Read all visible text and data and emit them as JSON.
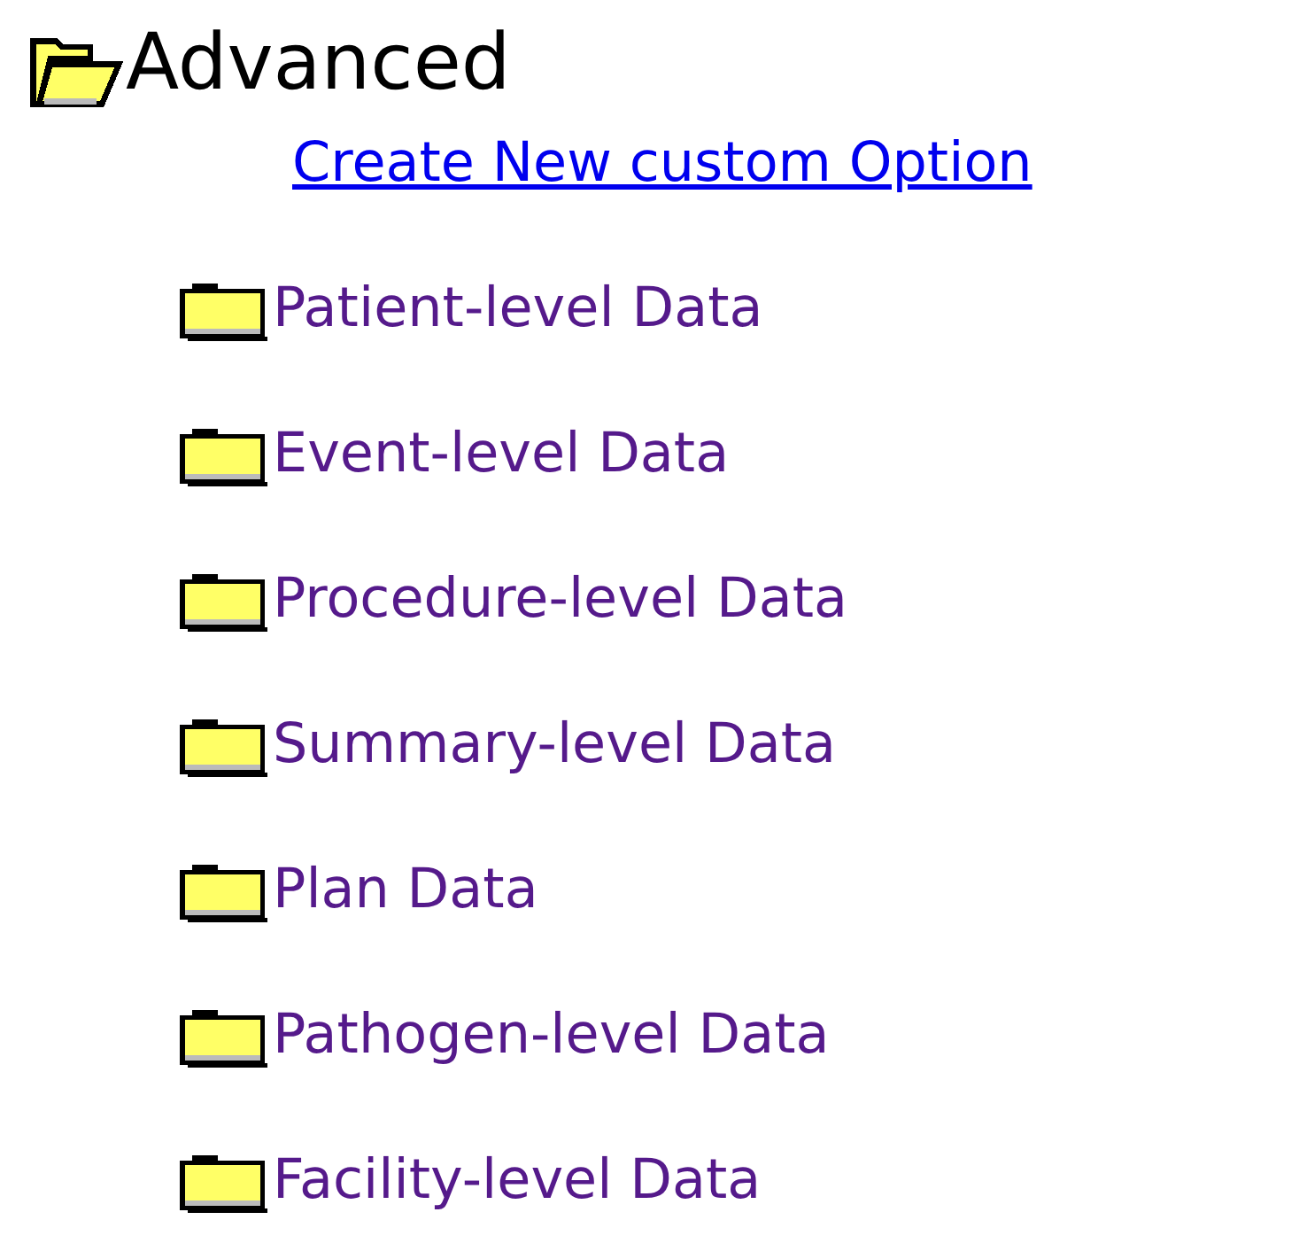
{
  "tree": {
    "label": "Advanced",
    "expanded": true,
    "children": [
      {
        "kind": "link",
        "label": "Create New custom Option"
      },
      {
        "kind": "folder",
        "label": "Patient-level Data",
        "expanded": false
      },
      {
        "kind": "folder",
        "label": "Event-level Data",
        "expanded": false
      },
      {
        "kind": "folder",
        "label": "Procedure-level Data",
        "expanded": false
      },
      {
        "kind": "folder",
        "label": "Summary-level Data",
        "expanded": false
      },
      {
        "kind": "folder",
        "label": "Plan Data",
        "expanded": false
      },
      {
        "kind": "folder",
        "label": "Pathogen-level Data",
        "expanded": false
      },
      {
        "kind": "folder",
        "label": "Facility-level Data",
        "expanded": false
      }
    ]
  }
}
